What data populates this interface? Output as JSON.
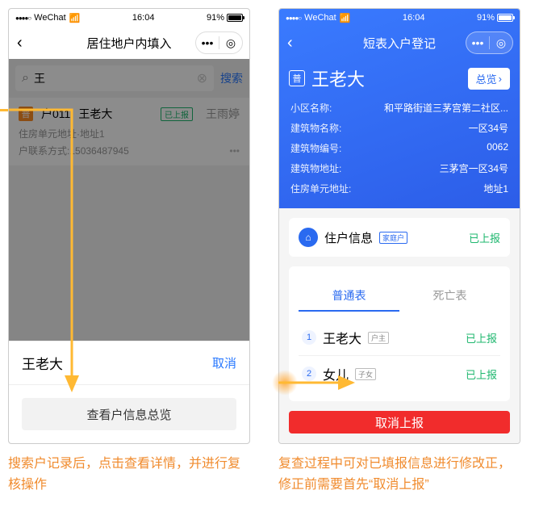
{
  "statusbar": {
    "carrier": "WeChat",
    "time": "16:04",
    "battery": "91%",
    "signal": "●●●●○",
    "wifi": "📶"
  },
  "phone1": {
    "title": "居住地户内填入",
    "capsule": {
      "more": "•••",
      "close": "◎"
    },
    "search": {
      "icon": "⌕",
      "value": "王",
      "clear": "⊗",
      "button": "搜索"
    },
    "result": {
      "badge": "普",
      "code": "户011",
      "name": "王老大",
      "status": "已上报",
      "reporter": "王雨婷",
      "addr": "住房单元地址·地址1",
      "contactLabel": "户联系方式:",
      "contact": "15036487945",
      "more": "•••"
    },
    "sheet": {
      "title": "王老大",
      "cancel": "取消",
      "button": "查看户信息总览"
    }
  },
  "phone2": {
    "title": "短表入户登记",
    "back": "‹",
    "capsule": {
      "more": "•••",
      "close": "◎"
    },
    "name": {
      "badge": "普",
      "name": "王老大",
      "overview": "总览",
      "chev": "›"
    },
    "info": [
      {
        "label": "小区名称:",
        "value": "和平路街道三茅宫第二社区..."
      },
      {
        "label": "建筑物名称:",
        "value": "一区34号"
      },
      {
        "label": "建筑物编号:",
        "value": "0062"
      },
      {
        "label": "建筑物地址:",
        "value": "三茅宫一区34号"
      },
      {
        "label": "住房单元地址:",
        "value": "地址1"
      }
    ],
    "house": {
      "icon": "⌂",
      "title": "住户信息",
      "tag": "家庭户",
      "status": "已上报"
    },
    "tabs": {
      "normal": "普通表",
      "death": "死亡表"
    },
    "members": [
      {
        "num": "1",
        "name": "王老大",
        "role": "户主",
        "status": "已上报"
      },
      {
        "num": "2",
        "name": "女儿",
        "role": "子女",
        "status": "已上报"
      }
    ],
    "cancelReport": "取消上报"
  },
  "captions": {
    "left": "搜索户记录后，点击查看详情，并进行复核操作",
    "right": "复查过程中可对已填报信息进行修改正，修正前需要首先“取消上报”"
  }
}
